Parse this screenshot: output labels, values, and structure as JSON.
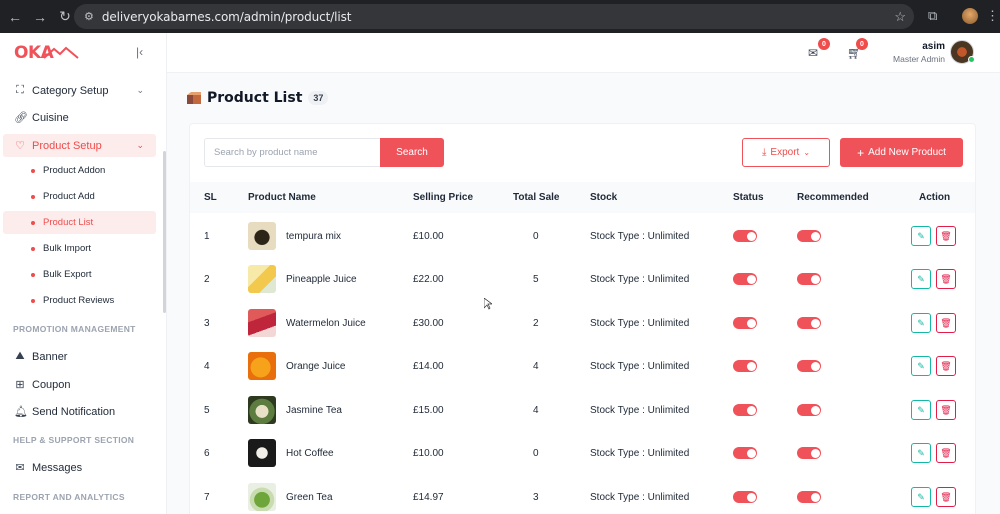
{
  "browser": {
    "url": "deliveryokabarnes.com/admin/product/list"
  },
  "sidebar": {
    "logo": "OKA",
    "menu": [
      {
        "label": "Category Setup",
        "icon": "sitemap-icon",
        "has_chevron": true
      },
      {
        "label": "Cuisine",
        "icon": "link-icon",
        "has_chevron": false
      },
      {
        "label": "Product Setup",
        "icon": "heart-icon",
        "has_chevron": true,
        "active": true
      }
    ],
    "submenu": [
      {
        "label": "Product Addon"
      },
      {
        "label": "Product Add"
      },
      {
        "label": "Product List",
        "active": true
      },
      {
        "label": "Bulk Import"
      },
      {
        "label": "Bulk Export"
      },
      {
        "label": "Product Reviews"
      }
    ],
    "promotion_title": "PROMOTION MANAGEMENT",
    "promotion_items": [
      {
        "label": "Banner",
        "icon": "image-icon"
      },
      {
        "label": "Coupon",
        "icon": "coupon-icon"
      },
      {
        "label": "Send Notification",
        "icon": "bell-icon"
      }
    ],
    "support_title": "HELP & SUPPORT SECTION",
    "support_items": [
      {
        "label": "Messages",
        "icon": "message-icon"
      }
    ],
    "report_title": "REPORT AND ANALYTICS"
  },
  "header": {
    "messages_badge": "0",
    "cart_badge": "0",
    "user_name": "asim",
    "user_role": "Master Admin"
  },
  "page": {
    "title": "Product List",
    "count": "37",
    "search_placeholder": "Search by product name",
    "search_button": "Search",
    "export_button": "Export",
    "add_button": "Add New Product"
  },
  "table": {
    "columns": [
      "SL",
      "Product Name",
      "Selling Price",
      "Total Sale",
      "Stock",
      "Status",
      "Recommended",
      "Action"
    ],
    "rows": [
      {
        "sl": "1",
        "name": "tempura mix",
        "price": "£10.00",
        "sale": "0",
        "stock": "Stock Type : Unlimited",
        "status": true,
        "recommended": true
      },
      {
        "sl": "2",
        "name": "Pineapple Juice",
        "price": "£22.00",
        "sale": "5",
        "stock": "Stock Type : Unlimited",
        "status": true,
        "recommended": true
      },
      {
        "sl": "3",
        "name": "Watermelon Juice",
        "price": "£30.00",
        "sale": "2",
        "stock": "Stock Type : Unlimited",
        "status": true,
        "recommended": true
      },
      {
        "sl": "4",
        "name": "Orange Juice",
        "price": "£14.00",
        "sale": "4",
        "stock": "Stock Type : Unlimited",
        "status": true,
        "recommended": true
      },
      {
        "sl": "5",
        "name": "Jasmine Tea",
        "price": "£15.00",
        "sale": "4",
        "stock": "Stock Type : Unlimited",
        "status": true,
        "recommended": true
      },
      {
        "sl": "6",
        "name": "Hot Coffee",
        "price": "£10.00",
        "sale": "0",
        "stock": "Stock Type : Unlimited",
        "status": true,
        "recommended": true
      },
      {
        "sl": "7",
        "name": "Green Tea",
        "price": "£14.97",
        "sale": "3",
        "stock": "Stock Type : Unlimited",
        "status": true,
        "recommended": true
      }
    ]
  },
  "colors": {
    "accent": "#f0525a",
    "accent_light": "#fdecec",
    "edit": "#14b8a6",
    "delete": "#e11d48"
  }
}
